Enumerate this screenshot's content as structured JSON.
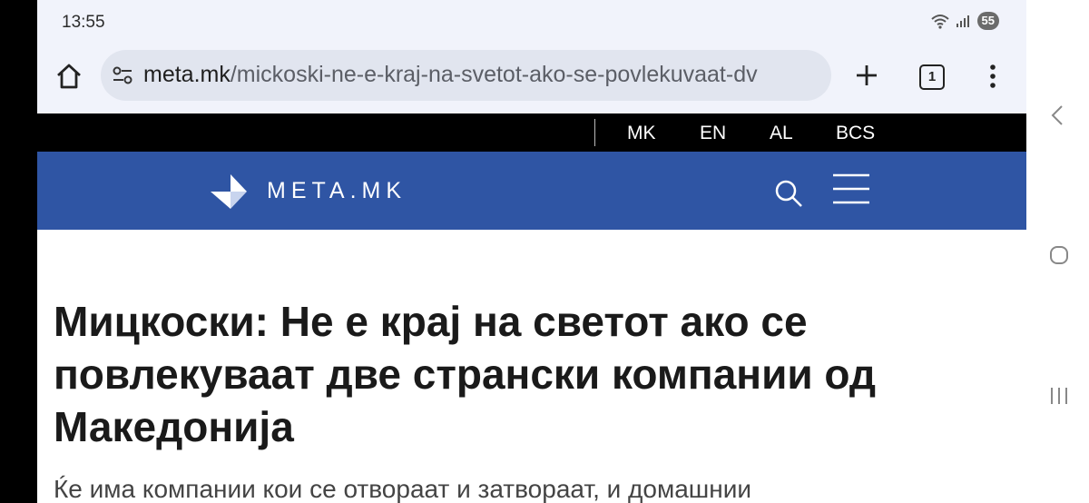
{
  "status_bar": {
    "time": "13:55",
    "battery": "55"
  },
  "browser": {
    "url_domain": "meta.mk",
    "url_path": "/mickoski-ne-e-kraj-na-svetot-ako-se-povlekuvaat-dv",
    "tab_count": "1",
    "icons": {
      "home": "home-icon",
      "site_settings": "tune-icon",
      "new_tab": "plus-icon",
      "tabs": "tab-switcher-icon",
      "menu": "more-vert-icon"
    }
  },
  "site": {
    "languages": [
      "MK",
      "EN",
      "AL",
      "BCS"
    ],
    "logo_text": "META.MK",
    "brand_color": "#2f55a4",
    "icons": {
      "search": "search-icon",
      "menu": "hamburger-icon"
    }
  },
  "article": {
    "title": "Мицкоски: Не е крај на светот ако се повлекуваат две странски компании од Македонија",
    "lead": "Ќе има компании кои се отвораат и затвораат, и домашнии"
  },
  "system_nav": {
    "icons": [
      "back-icon",
      "home-circle-icon",
      "recents-icon"
    ]
  }
}
